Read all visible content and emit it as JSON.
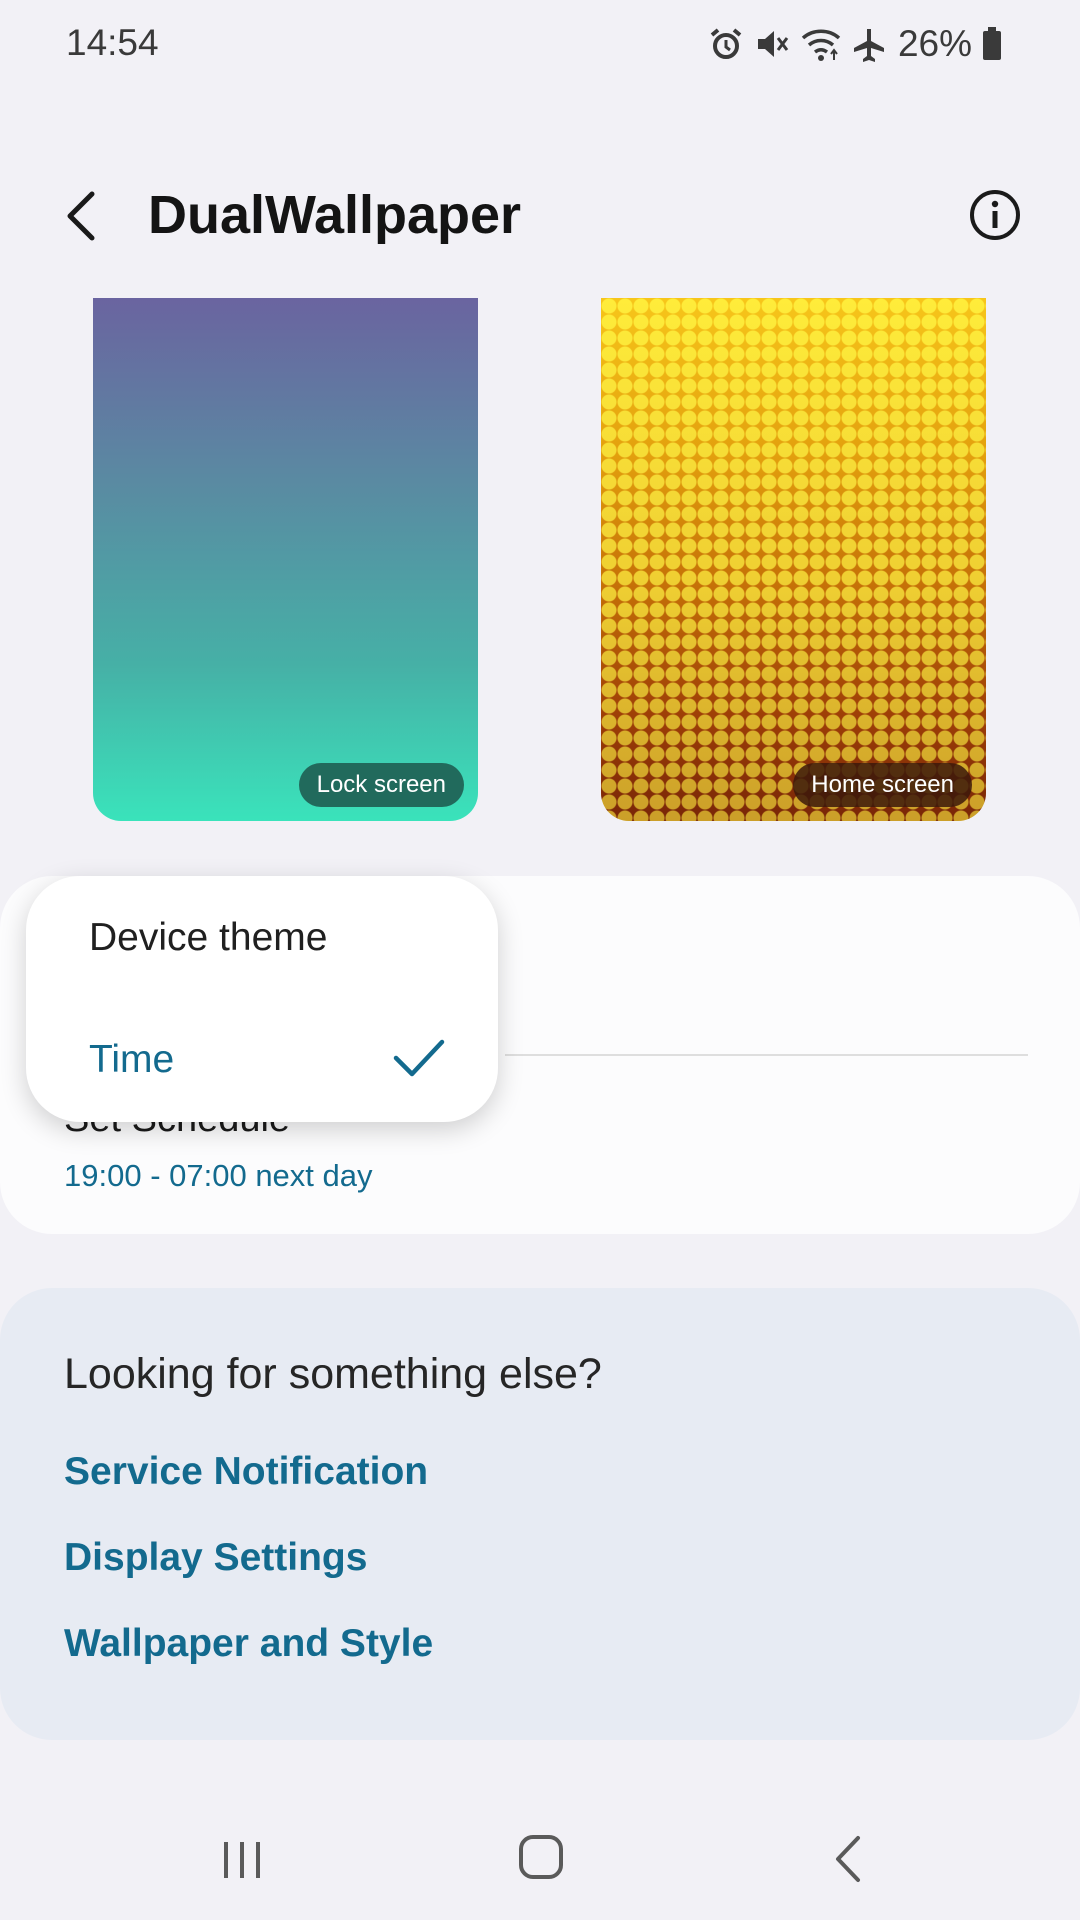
{
  "status_bar": {
    "time": "14:54",
    "battery": "26%",
    "icons": [
      "alarm-icon",
      "mute-icon",
      "wifi-icon",
      "airplane-icon",
      "battery-icon"
    ]
  },
  "app_bar": {
    "title": "DualWallpaper",
    "back_icon": "chevron-left-icon",
    "info_icon": "info-icon"
  },
  "previews": {
    "lock_label": "Lock screen",
    "home_label": "Home screen"
  },
  "menu": {
    "items": [
      {
        "label": "Device theme",
        "selected": false
      },
      {
        "label": "Time",
        "selected": true
      }
    ]
  },
  "schedule": {
    "title": "Set Schedule",
    "value": "19:00 - 07:00 next day"
  },
  "help": {
    "title": "Looking for something else?",
    "links": [
      "Service Notification",
      "Display Settings",
      "Wallpaper and Style"
    ]
  },
  "colors": {
    "accent": "#136a8e",
    "background": "#f2f1f6",
    "card": "#fcfcfd",
    "help_card": "#e7ebf3"
  }
}
